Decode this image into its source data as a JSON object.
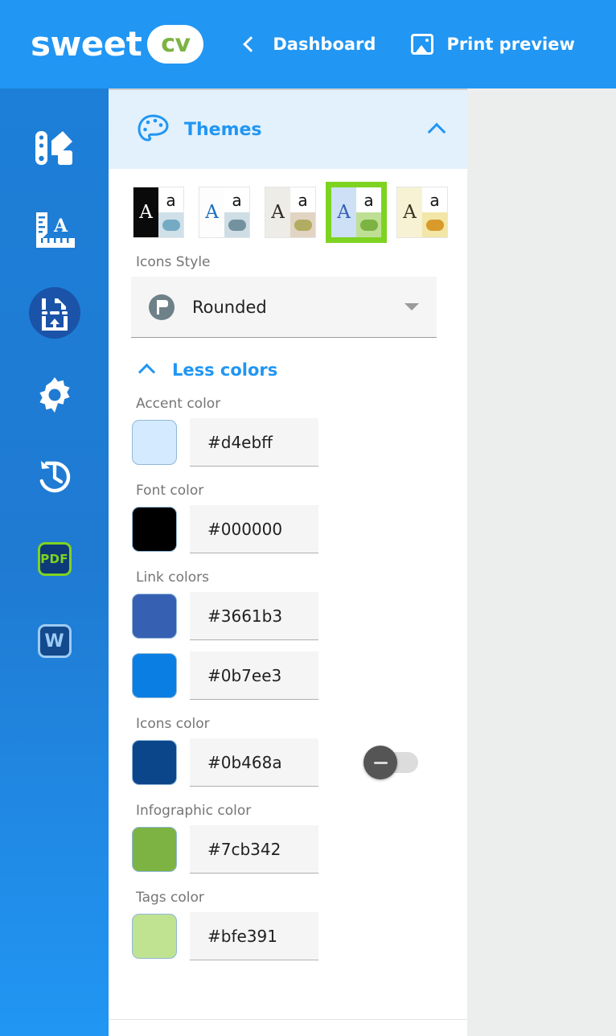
{
  "header": {
    "logo_text": "sweet",
    "logo_badge_text": "cv",
    "back_icon": "chevron-left-icon",
    "dashboard_label": "Dashboard",
    "print_icon": "image-icon",
    "print_preview_label": "Print preview",
    "bg_color": "#2196f3"
  },
  "sidebar": {
    "items": [
      {
        "name": "palette-swatches",
        "icon": "color-swatch-icon",
        "active": false
      },
      {
        "name": "typography-ruler",
        "icon": "ruler-letter-icon",
        "active": false
      },
      {
        "name": "page-break",
        "icon": "page-break-upload-icon",
        "active": true
      },
      {
        "name": "settings",
        "icon": "gear-icon",
        "active": false
      },
      {
        "name": "history",
        "icon": "history-clock-icon",
        "active": false
      },
      {
        "name": "export-pdf",
        "icon": "pdf-badge-icon",
        "label": "PDF",
        "active": false
      },
      {
        "name": "export-word",
        "icon": "word-badge-icon",
        "label": "W",
        "active": false
      }
    ]
  },
  "panel": {
    "section_title": "Themes",
    "section_icon": "palette-icon",
    "collapse_icon": "chevron-up-icon",
    "themes": [
      {
        "id": "theme-1",
        "left_bg": "#0a0a0a",
        "letter_a_color": "#ffffff",
        "small_a_color": "#111111",
        "bottom_bg": "#cfe0e9",
        "pill_color": "#74aac4",
        "selected": false
      },
      {
        "id": "theme-2",
        "left_bg": "#fdfdfd",
        "letter_a_color": "#1c6fc0",
        "small_a_color": "#111111",
        "bottom_bg": "#cfdde5",
        "pill_color": "#74919f",
        "selected": false
      },
      {
        "id": "theme-3",
        "left_bg": "#eeece7",
        "letter_a_color": "#2f2a22",
        "small_a_color": "#111111",
        "bottom_bg": "#e2d4c3",
        "pill_color": "#b2ac62",
        "selected": false
      },
      {
        "id": "theme-4",
        "left_bg": "#cde0f5",
        "letter_a_color": "#3661b3",
        "small_a_color": "#111111",
        "bottom_bg": "#bfdf95",
        "pill_color": "#7cb342",
        "selected": true
      },
      {
        "id": "theme-5",
        "left_bg": "#f7f2d4",
        "letter_a_color": "#3a3325",
        "small_a_color": "#111111",
        "bottom_bg": "#f2e6a8",
        "pill_color": "#d99a2b",
        "selected": false
      }
    ],
    "icons_style": {
      "label": "Icons Style",
      "value": "Rounded",
      "icon": "flag-circle-icon",
      "dropdown_icon": "caret-down-icon"
    },
    "less_colors": {
      "label": "Less colors",
      "icon": "chevron-up-icon"
    },
    "colors": [
      {
        "label": "Accent color",
        "value": "#d4ebff",
        "swatch": "#d4ebff",
        "toggle": null
      },
      {
        "label": "Font color",
        "value": "#000000",
        "swatch": "#000000",
        "toggle": null
      },
      {
        "label": "Link colors",
        "value": "#3661b3",
        "swatch": "#3661b3",
        "toggle": null
      },
      {
        "label": "",
        "value": "#0b7ee3",
        "swatch": "#0b7ee3",
        "toggle": null
      },
      {
        "label": "Icons color",
        "value": "#0b468a",
        "swatch": "#0b468a",
        "toggle": "off"
      },
      {
        "label": "Infographic color",
        "value": "#7cb342",
        "swatch": "#7cb342",
        "toggle": null
      },
      {
        "label": "Tags color",
        "value": "#bfe391",
        "swatch": "#bfe391",
        "toggle": null
      }
    ]
  },
  "canvas": {
    "bg_color": "#eceded"
  }
}
